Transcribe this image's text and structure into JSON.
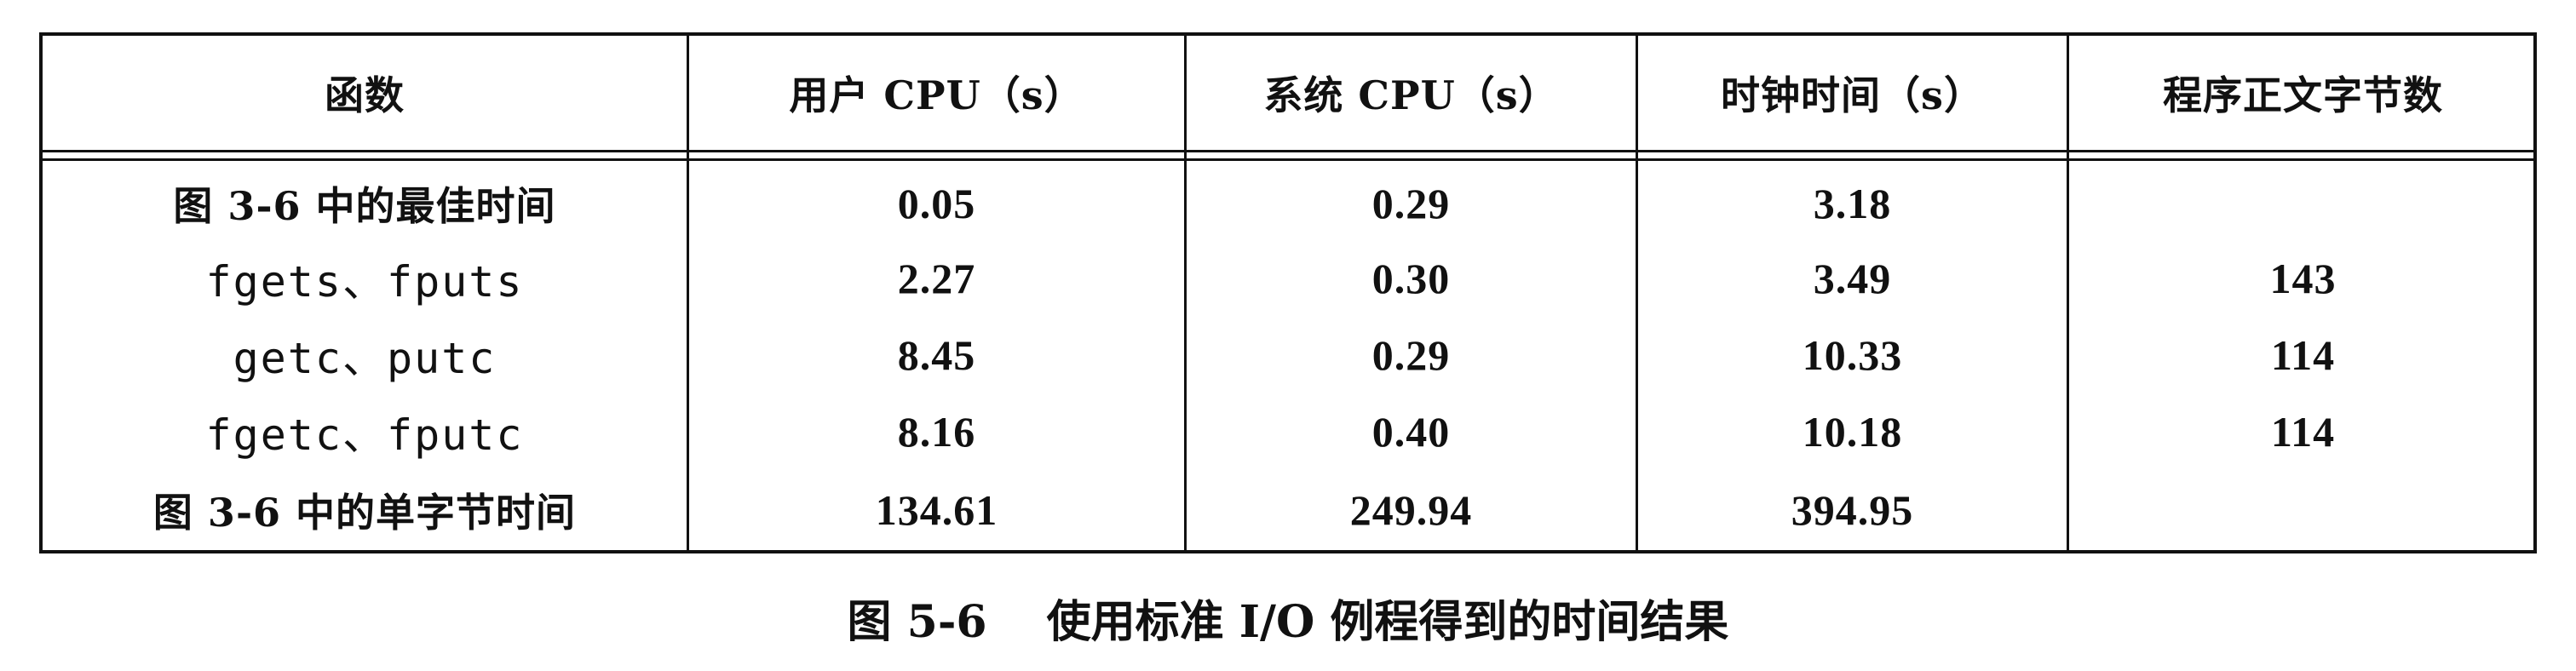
{
  "table": {
    "headers": [
      "函数",
      "用户 CPU（s）",
      "系统 CPU（s）",
      "时钟时间（s）",
      "程序正文字节数"
    ],
    "rows": [
      {
        "function": "图 3-6 中的最佳时间",
        "user_cpu": "0.05",
        "system_cpu": "0.29",
        "clock_time": "3.18",
        "text_bytes": ""
      },
      {
        "function": "fgets、fputs",
        "user_cpu": "2.27",
        "system_cpu": "0.30",
        "clock_time": "3.49",
        "text_bytes": "143"
      },
      {
        "function": "getc、putc",
        "user_cpu": "8.45",
        "system_cpu": "0.29",
        "clock_time": "10.33",
        "text_bytes": "114"
      },
      {
        "function": "fgetc、fputc",
        "user_cpu": "8.16",
        "system_cpu": "0.40",
        "clock_time": "10.18",
        "text_bytes": "114"
      },
      {
        "function": "图 3-6 中的单字节时间",
        "user_cpu": "134.61",
        "system_cpu": "249.94",
        "clock_time": "394.95",
        "text_bytes": ""
      }
    ]
  },
  "caption": {
    "figure_number": "图 5-6",
    "text": "使用标准 I/O 例程得到的时间结果"
  }
}
